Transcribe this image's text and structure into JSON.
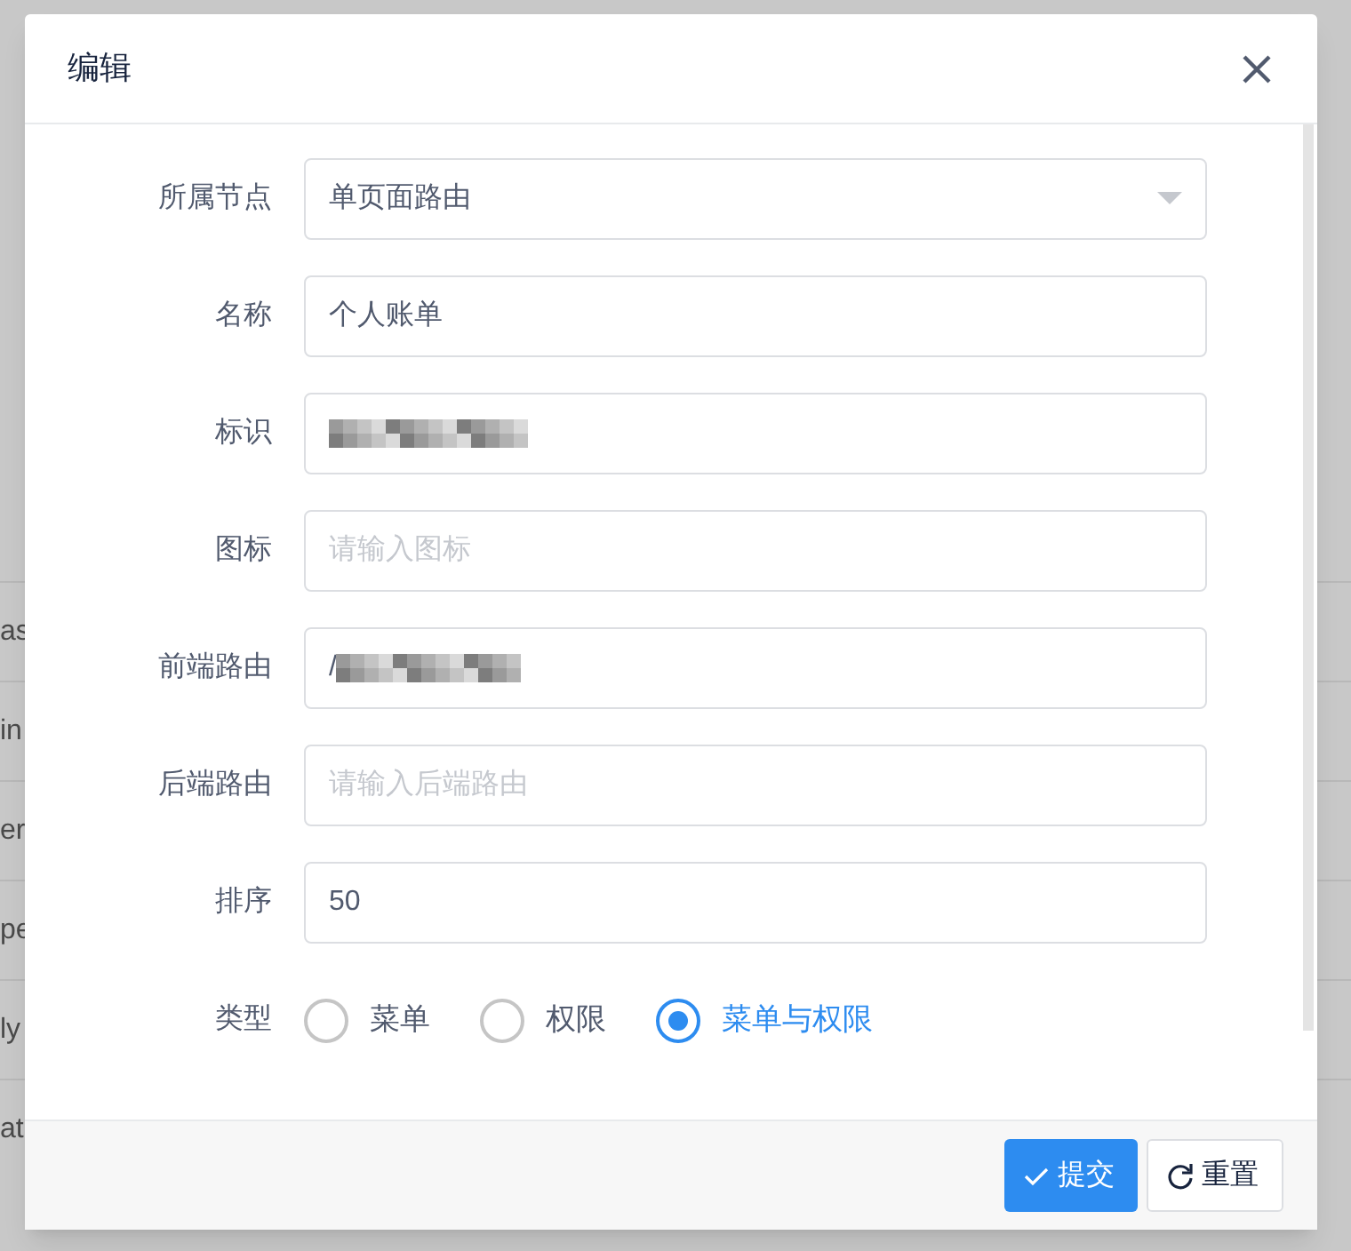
{
  "background_table": {
    "rows": [
      {
        "column_1": "as"
      },
      {
        "column_1": "in"
      },
      {
        "column_1": "er"
      },
      {
        "column_1": "pe"
      },
      {
        "column_1": "ly"
      },
      {
        "column_1": "at"
      }
    ]
  },
  "dialog": {
    "title": "编辑",
    "fields": [
      {
        "kind": "select",
        "label": "所属节点",
        "value": "单页面路由"
      },
      {
        "kind": "input",
        "label": "名称",
        "value": "个人账单"
      },
      {
        "kind": "input",
        "label": "标识",
        "redacted": true
      },
      {
        "kind": "input",
        "label": "图标",
        "placeholder": "请输入图标"
      },
      {
        "kind": "input",
        "label": "前端路由",
        "value": "/",
        "redacted": true
      },
      {
        "kind": "input",
        "label": "后端路由",
        "placeholder": "请输入后端路由"
      },
      {
        "kind": "input",
        "label": "排序",
        "value": "50"
      },
      {
        "kind": "radio",
        "label": "类型",
        "options": [
          {
            "label": "菜单",
            "selected": false
          },
          {
            "label": "权限",
            "selected": false
          },
          {
            "label": "菜单与权限",
            "selected": true
          }
        ]
      }
    ],
    "buttons": [
      {
        "kind": "primary",
        "label": "提交"
      },
      {
        "kind": "default",
        "label": "重置"
      }
    ]
  }
}
